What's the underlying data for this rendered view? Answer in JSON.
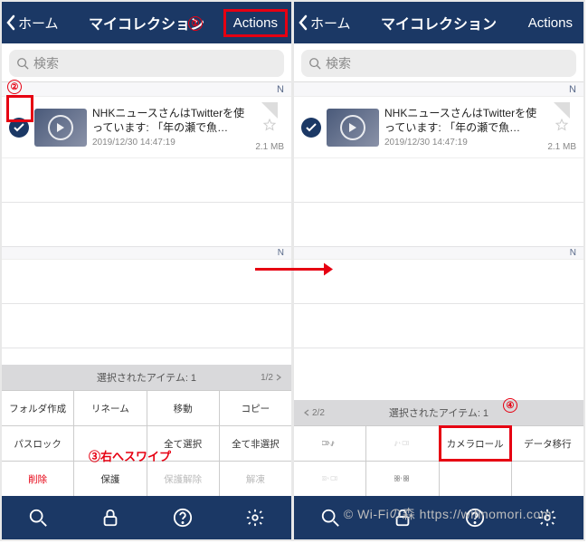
{
  "nav": {
    "back_label": "ホーム",
    "title": "マイコレクション",
    "actions_label": "Actions"
  },
  "search": {
    "placeholder": "検索"
  },
  "section_letter": "N",
  "item": {
    "title": "NHKニュースさんはTwitterを使っています:  「年の瀬で魚…",
    "date": "2019/12/30 14:47:19",
    "size": "2.1 MB"
  },
  "panel": {
    "header": "選択されたアイテム: 1",
    "page1": "1/2",
    "page2": "2/2",
    "buttons_p1": [
      "フォルダ作成",
      "リネーム",
      "移動",
      "コピー",
      "パスロック",
      "",
      "全て選択",
      "全て非選択",
      "削除",
      "保護",
      "保護解除",
      "解凍"
    ],
    "camera_roll": "カメラロール",
    "data_migrate": "データ移行"
  },
  "annot": {
    "a1": "①",
    "a2": "②",
    "a3_text": "③右へスワイプ",
    "a4": "④"
  },
  "watermark": "© Wi-Fiの森  https://wifinomori.com"
}
